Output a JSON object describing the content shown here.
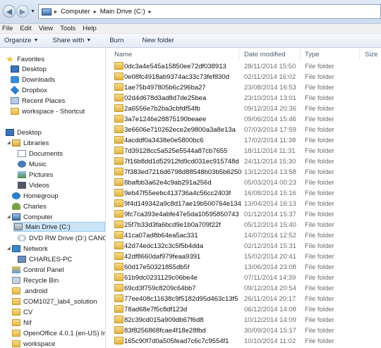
{
  "address": {
    "segments": [
      "Computer",
      "Main Drive (C:)"
    ]
  },
  "menu": [
    "File",
    "Edit",
    "View",
    "Tools",
    "Help"
  ],
  "toolbar": {
    "organize": "Organize",
    "share": "Share with",
    "burn": "Burn",
    "new_folder": "New folder"
  },
  "sidebar": {
    "favorites_title": "Favorites",
    "favorites": [
      "Desktop",
      "Downloads",
      "Dropbox",
      "Recent Places",
      "workspace - Shortcut"
    ],
    "desktop": "Desktop",
    "libraries": "Libraries",
    "library_items": [
      "Documents",
      "Music",
      "Pictures",
      "Videos"
    ],
    "homegroup": "Homegroup",
    "user": "Charles",
    "computer": "Computer",
    "drives": [
      "Main Drive (C:)",
      "DVD RW Drive (D:) CANOSCA"
    ],
    "network": "Network",
    "network_pc": "CHARLES-PC",
    "control_panel": "Control Panel",
    "recycle_bin": "Recycle Bin",
    "folders": [
      ".android",
      "COM1027_lab4_solution",
      "CV",
      "Nif",
      "OpenOffice 4.0.1 (en-US) Instal",
      "workspace"
    ]
  },
  "columns": {
    "name": "Name",
    "date": "Date modified",
    "type": "Type",
    "size": "Size"
  },
  "files": [
    {
      "name": "0dc3a4e545a15850ee72df038913",
      "date": "28/11/2014 15:50",
      "type": "File folder"
    },
    {
      "name": "0e08fc4918ab9374ac33c73fef830d",
      "date": "02/11/2014 16:02",
      "type": "File folder"
    },
    {
      "name": "1ae75b497805b6c296ba27",
      "date": "23/08/2014 16:53",
      "type": "File folder"
    },
    {
      "name": "02d4d678d3ad8d7de25bea",
      "date": "23/10/2014 13:01",
      "type": "File folder"
    },
    {
      "name": "2a6556e7b2ba3cbfdf54fb",
      "date": "09/12/2014 20:36",
      "type": "File folder"
    },
    {
      "name": "3a7e1246e28875190beaee",
      "date": "09/06/2014 15:46",
      "type": "File folder"
    },
    {
      "name": "3e6606e710262ece2e9800a3a8e13a",
      "date": "07/03/2014 17:59",
      "type": "File folder"
    },
    {
      "name": "4acddf0a3438e0e5800bc6",
      "date": "17/02/2014 11:38",
      "type": "File folder"
    },
    {
      "name": "7d39128cc5a525e5544a87cb7655",
      "date": "18/11/2014 11:31",
      "type": "File folder"
    },
    {
      "name": "7f16b8dd1d52912fd9cd031ec915748d",
      "date": "24/11/2014 15:30",
      "type": "File folder"
    },
    {
      "name": "7f383ed7216d6798d88548b03b5b6250",
      "date": "13/12/2014 13:58",
      "type": "File folder"
    },
    {
      "name": "8bafbb3a62e4c9ab291a256d",
      "date": "05/03/2014 00:23",
      "type": "File folder"
    },
    {
      "name": "9eb47f55eebc413736a4c56cc2403f",
      "date": "16/08/2014 15:16",
      "type": "File folder"
    },
    {
      "name": "9f4d149342a9c8d17ae19b500764e134",
      "date": "13/04/2014 16:13",
      "type": "File folder"
    },
    {
      "name": "9fc7ca393e4abfe47e5da10595850743",
      "date": "01/12/2014 15:37",
      "type": "File folder"
    },
    {
      "name": "25f7b33d3fa6bcd9e1b0a709f22f",
      "date": "05/12/2014 15:40",
      "type": "File folder"
    },
    {
      "name": "41ca07ad8b64ea5ac331",
      "date": "14/07/2014 12:52",
      "type": "File folder"
    },
    {
      "name": "42d74edc132c3c5f5b4dda",
      "date": "02/12/2014 15:31",
      "type": "File folder"
    },
    {
      "name": "42df8660daf979feaa9391",
      "date": "15/02/2014 20:41",
      "type": "File folder"
    },
    {
      "name": "60d17e50321855db5f",
      "date": "13/06/2014 23:08",
      "type": "File folder"
    },
    {
      "name": "61b9dc0231129c06be4e",
      "date": "07/11/2014 14:39",
      "type": "File folder"
    },
    {
      "name": "69cd3f759c8209c64bb7",
      "date": "09/12/2014 20:54",
      "type": "File folder"
    },
    {
      "name": "77ee408c11638c9f5182d95d463c13f5",
      "date": "26/11/2014 20:17",
      "type": "File folder"
    },
    {
      "name": "78ad68e7f5c8df123d",
      "date": "06/12/2014 14:08",
      "type": "File folder"
    },
    {
      "name": "82c39cd015a909db67f6d8",
      "date": "10/12/2014 14:09",
      "type": "File folder"
    },
    {
      "name": "83f8256868fcae4f18e28fbd",
      "date": "30/09/2014 15:17",
      "type": "File folder"
    },
    {
      "name": "165c90f7d0a505fead7c6c7c9554f1",
      "date": "10/10/2014 11:02",
      "type": "File folder"
    }
  ]
}
